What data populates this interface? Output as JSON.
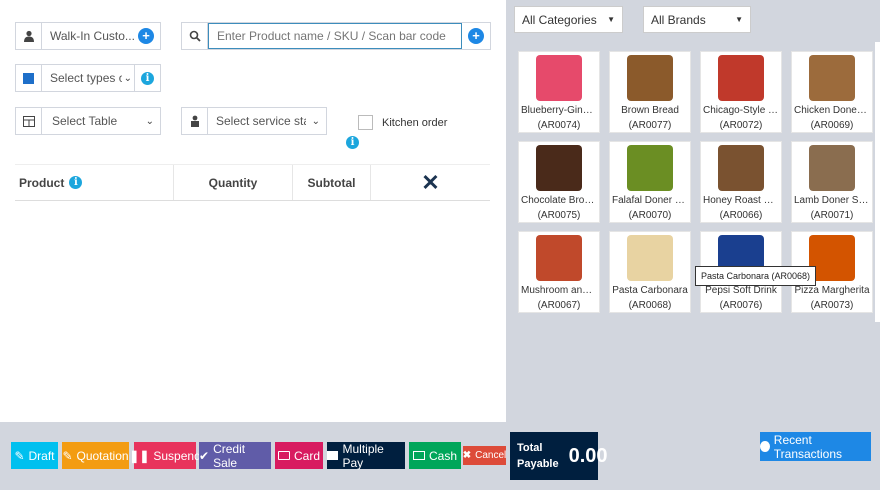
{
  "left": {
    "customer": {
      "value": "Walk-In Custo..."
    },
    "search": {
      "placeholder": "Enter Product name / SKU / Scan bar code"
    },
    "types_of_service": {
      "value": "Select types of s"
    },
    "table_select": {
      "value": "Select Table"
    },
    "service_staff": {
      "value": "Select service staff"
    },
    "kitchen_order_label": "Kitchen order",
    "table": {
      "product_header": "Product",
      "quantity_header": "Quantity",
      "subtotal_header": "Subtotal",
      "remove_icon": "✕"
    }
  },
  "footer": {
    "draft": "Draft",
    "quotation": "Quotation",
    "suspend": "Suspend",
    "credit_sale": "Credit Sale",
    "card": "Card",
    "multiple_pay": "Multiple Pay",
    "cash": "Cash",
    "cancel": "Cancel",
    "total_payable_line1": "Total",
    "total_payable_line2": "Payable",
    "total_payable_value": "0.00",
    "recent_transactions": "Recent Transactions"
  },
  "colors": {
    "draft": "#00c0ef",
    "quotation": "#f39c12",
    "suspend": "#e8335c",
    "credit_sale": "#605ca8",
    "card": "#d81b60",
    "multiple_pay": "#001f3f",
    "cash": "#00a65a",
    "cancel": "#dd4b39",
    "recent": "#1e88e5"
  },
  "filters": {
    "categories": "All Categories",
    "brands": "All Brands"
  },
  "products": [
    {
      "name": "Blueberry-Ginger...",
      "sku": "(AR0074)",
      "icon": "drink-image"
    },
    {
      "name": "Brown Bread",
      "sku": "(AR0077)",
      "icon": "bread-image"
    },
    {
      "name": "Chicago-Style Pan...",
      "sku": "(AR0072)",
      "icon": "pizza-image"
    },
    {
      "name": "Chicken Doner Pita...",
      "sku": "(AR0069)",
      "icon": "pita-image"
    },
    {
      "name": "Chocolate Brownie",
      "sku": "(AR0075)",
      "icon": "brownie-image"
    },
    {
      "name": "Falafal Doner Salad",
      "sku": "(AR0070)",
      "icon": "salad-image"
    },
    {
      "name": "Honey Roast Chicken",
      "sku": "(AR0066)",
      "icon": "chicken-image"
    },
    {
      "name": "Lamb Doner Salad",
      "sku": "(AR0071)",
      "icon": "lamb-image"
    },
    {
      "name": "Mushroom and Her...",
      "sku": "(AR0067)",
      "icon": "mushroom-pizza-image"
    },
    {
      "name": "Pasta Carbonara",
      "sku": "(AR0068)",
      "icon": "pasta-image"
    },
    {
      "name": "Pepsi Soft Drink",
      "sku": "(AR0076)",
      "icon": "soda-image"
    },
    {
      "name": "Pizza Margherita",
      "sku": "(AR0073)",
      "icon": "margherita-image"
    }
  ],
  "tooltip": "Pasta Carbonara (AR0068)"
}
